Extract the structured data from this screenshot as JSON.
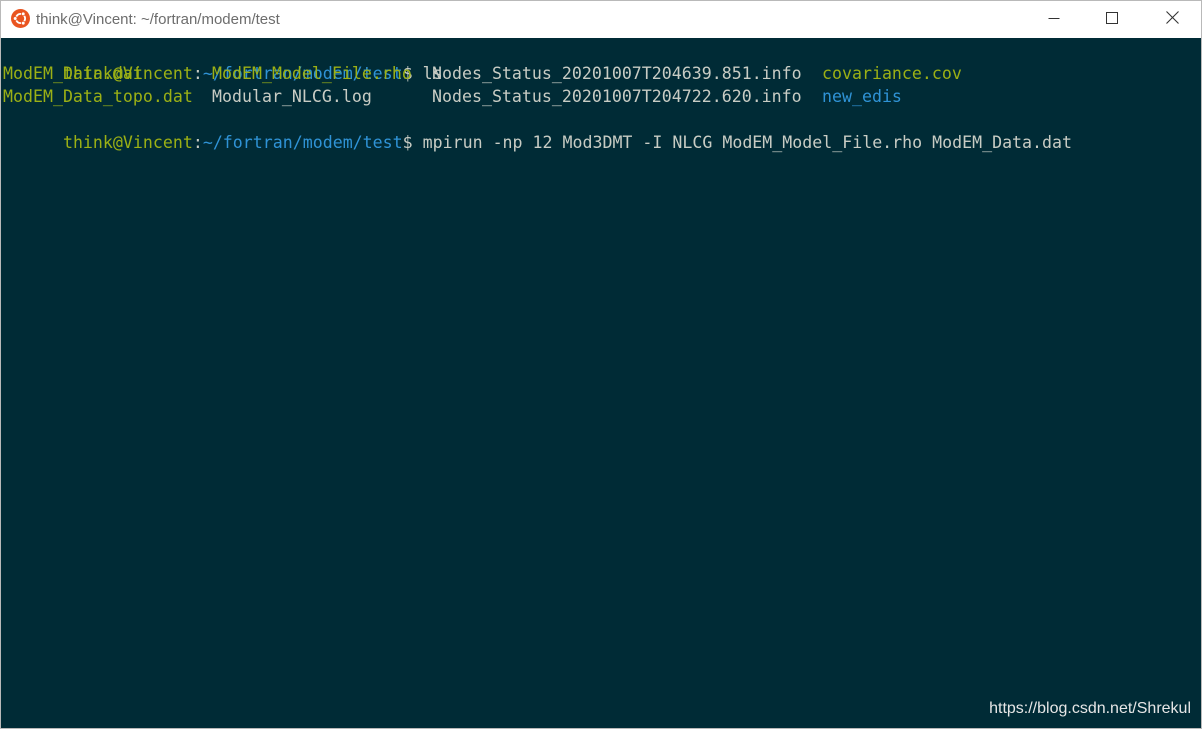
{
  "window": {
    "title": "think@Vincent: ~/fortran/modem/test",
    "app_icon": "ubuntu-icon",
    "controls": {
      "minimize_icon": "minimize-icon",
      "maximize_icon": "maximize-icon",
      "close_icon": "close-icon"
    }
  },
  "colors": {
    "background": "#002b36",
    "prompt_user": "#9bb015",
    "prompt_path": "#2f93d6",
    "text": "#c8ccc4",
    "file_green": "#9bb015",
    "dir_blue": "#2f93d6"
  },
  "terminal": {
    "line1": {
      "user_host": "think@Vincent",
      "colon": ":",
      "path": "~/fortran/modem/test",
      "dollar": "$",
      "command": " ls"
    },
    "ls_output": {
      "row1": [
        "ModEM_Data.dat",
        "ModEM_Model_File.rho",
        "Nodes_Status_20201007T204639.851.info",
        "covariance.cov"
      ],
      "row2": [
        "ModEM_Data_topo.dat",
        "Modular_NLCG.log",
        "Nodes_Status_20201007T204722.620.info",
        "new_edis"
      ]
    },
    "line4": {
      "user_host": "think@Vincent",
      "colon": ":",
      "path": "~/fortran/modem/test",
      "dollar": "$",
      "command": " mpirun -np 12 Mod3DMT -I NLCG ModEM_Model_File.rho ModEM_Data.dat"
    }
  },
  "watermark": "https://blog.csdn.net/Shrekul"
}
